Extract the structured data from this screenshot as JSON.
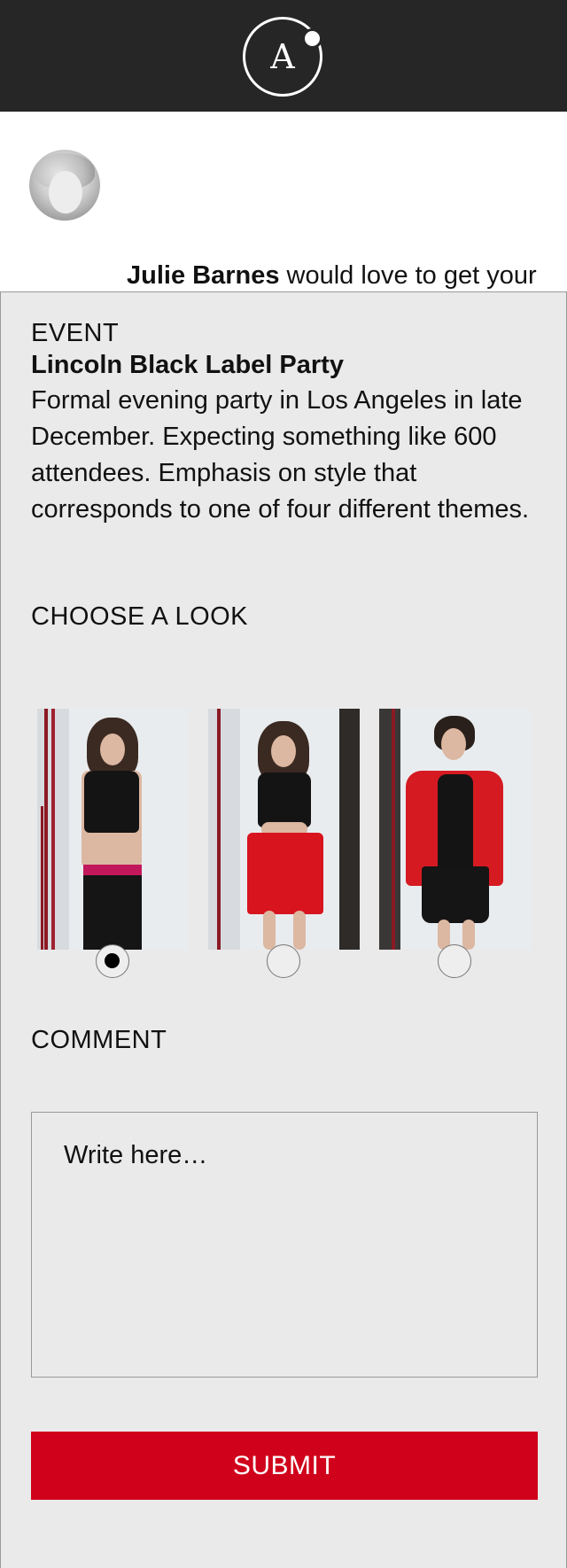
{
  "header": {
    "logo_letter": "A"
  },
  "intro": {
    "requester_name": "Julie Barnes",
    "message": " would love to get your feedback on what to wear for the following event."
  },
  "event": {
    "section_label": "EVENT",
    "name": "Lincoln Black Label Party",
    "description": "Formal evening party in Los Angeles in late December. Expecting something like 600 attendees. Emphasis on style that corresponds to one of four different themes."
  },
  "looks": {
    "section_label": "CHOOSE A LOOK",
    "options": [
      {
        "icon": "look-photo-crop-top-black-pants",
        "selected": true
      },
      {
        "icon": "look-photo-crop-top-red-skirt",
        "selected": false
      },
      {
        "icon": "look-photo-red-blazer-black-skirt",
        "selected": false
      }
    ]
  },
  "comment": {
    "section_label": "COMMENT",
    "placeholder": "Write here…"
  },
  "submit": {
    "label": "SUBMIT"
  },
  "colors": {
    "header_bg": "#262626",
    "panel_bg": "#eaeaea",
    "accent_red": "#d0021b"
  }
}
